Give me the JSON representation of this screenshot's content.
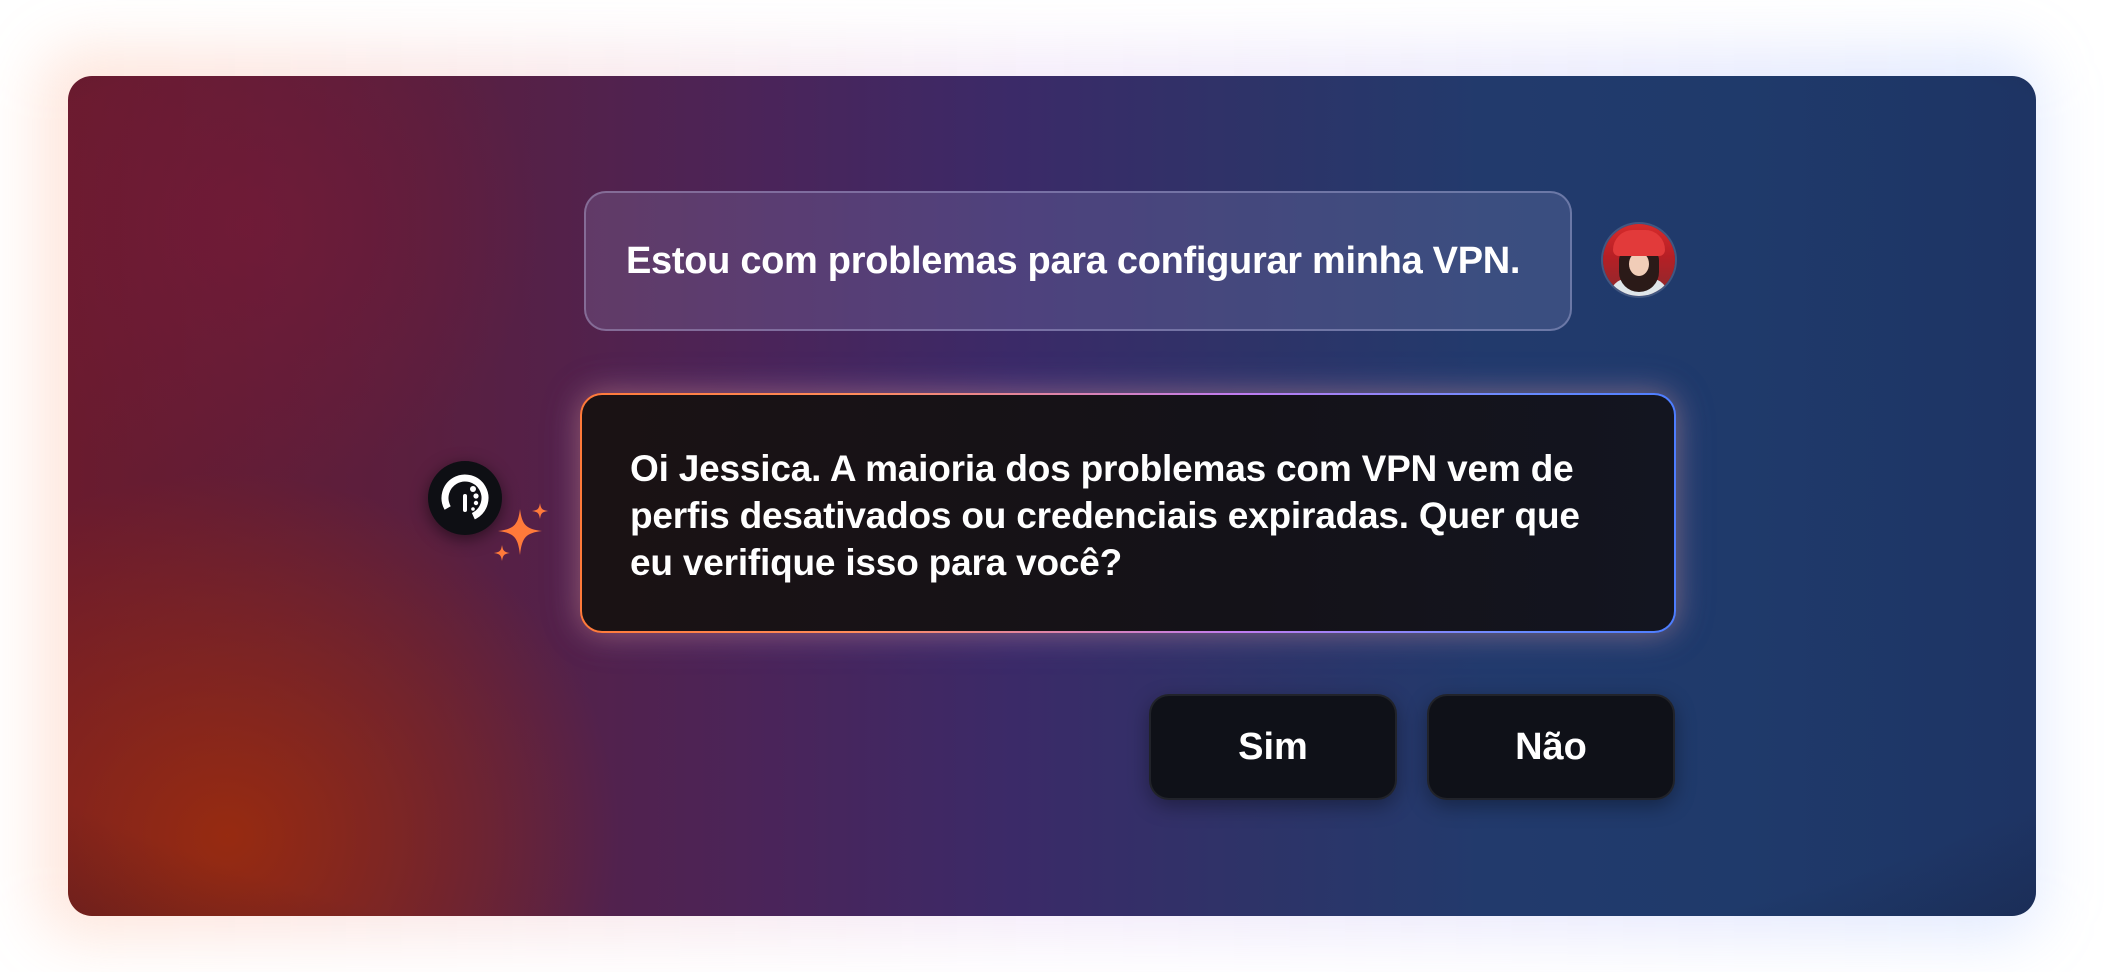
{
  "conversation": {
    "user_message": "Estou com problemas para configurar minha VPN.",
    "assistant_message": "Oi Jessica. A maioria dos problemas com VPN vem de perfis desativados ou credenciais expiradas. Quer que eu verifique isso para você?"
  },
  "actions": {
    "yes_label": "Sim",
    "no_label": "Não"
  },
  "icons": {
    "user_avatar": "user-avatar-photo",
    "assistant_logo": "assistant-logo-icon",
    "sparkle": "sparkle-icon"
  },
  "colors": {
    "accent_orange": "#ff7a3a",
    "accent_blue": "#4d7dff",
    "sparkle": "#ff7a3a",
    "button_bg": "#0f1118"
  }
}
